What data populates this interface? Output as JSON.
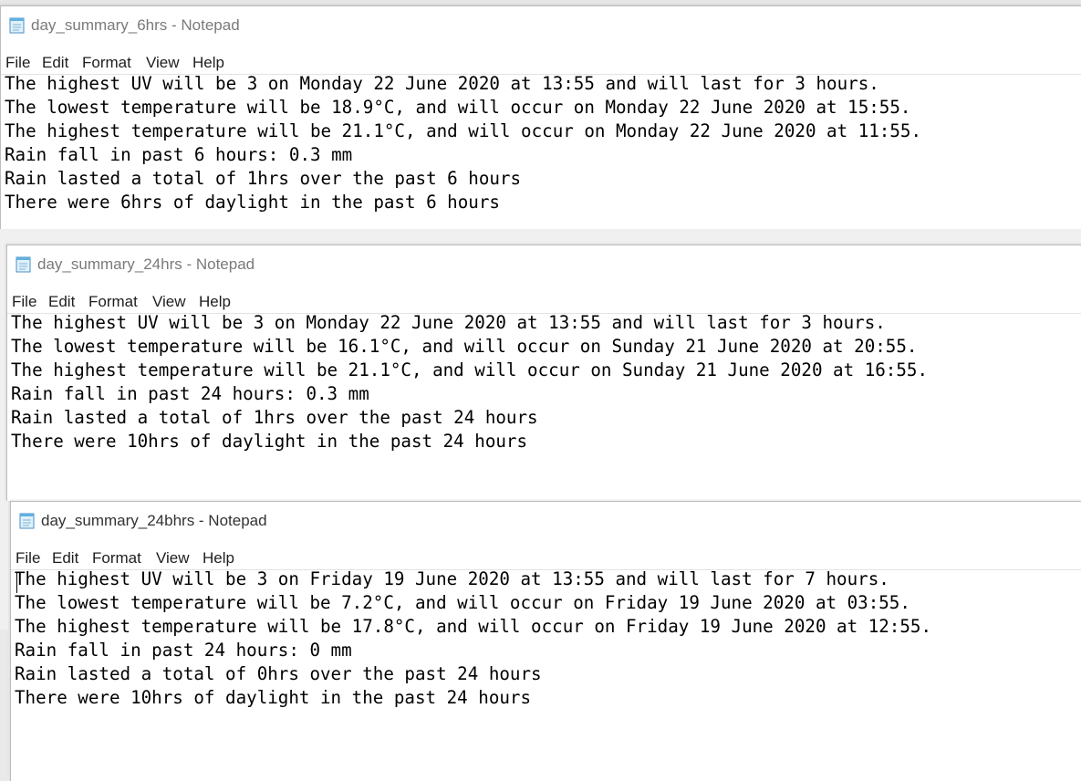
{
  "windows": [
    {
      "title": "day_summary_6hrs - Notepad",
      "menu": [
        "File",
        "Edit",
        "Format",
        "View",
        "Help"
      ],
      "lines": [
        "The highest UV will be 3 on Monday 22 June 2020 at 13:55 and will last for 3 hours.",
        "The lowest temperature will be 18.9°C, and will occur on Monday 22 June 2020 at 15:55.",
        "The highest temperature will be 21.1°C, and will occur on Monday 22 June 2020 at 11:55.",
        "Rain fall in past 6 hours: 0.3 mm",
        "Rain lasted a total of 1hrs over the past 6 hours",
        "There were 6hrs of daylight in the past 6 hours"
      ]
    },
    {
      "title": "day_summary_24hrs - Notepad",
      "menu": [
        "File",
        "Edit",
        "Format",
        "View",
        "Help"
      ],
      "lines": [
        "The highest UV will be 3 on Monday 22 June 2020 at 13:55 and will last for 3 hours.",
        "The lowest temperature will be 16.1°C, and will occur on Sunday 21 June 2020 at 20:55.",
        "The highest temperature will be 21.1°C, and will occur on Sunday 21 June 2020 at 16:55.",
        "Rain fall in past 24 hours: 0.3 mm",
        "Rain lasted a total of 1hrs over the past 24 hours",
        "There were 10hrs of daylight in the past 24 hours"
      ]
    },
    {
      "title": "day_summary_24bhrs - Notepad",
      "menu": [
        "File",
        "Edit",
        "Format",
        "View",
        "Help"
      ],
      "lines": [
        "The highest UV will be 3 on Friday 19 June 2020 at 13:55 and will last for 7 hours.",
        "The lowest temperature will be 7.2°C, and will occur on Friday 19 June 2020 at 03:55.",
        "The highest temperature will be 17.8°C, and will occur on Friday 19 June 2020 at 12:55.",
        "Rain fall in past 24 hours: 0 mm",
        "Rain lasted a total of 0hrs over the past 24 hours",
        "There were 10hrs of daylight in the past 24 hours"
      ]
    }
  ],
  "icons": {
    "app": "notepad-icon"
  },
  "colors": {
    "title_text": "#7a7a7a",
    "menu_text": "#1e1e1e",
    "body_text": "#000000"
  }
}
